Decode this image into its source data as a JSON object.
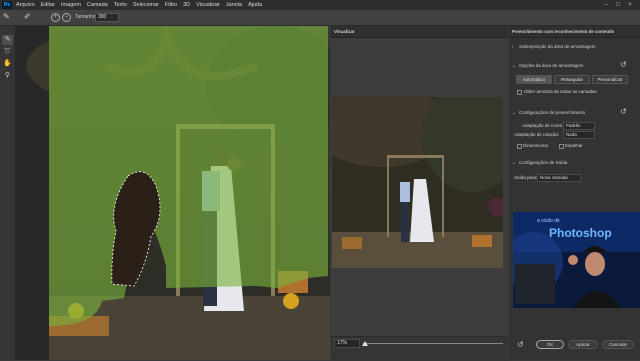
{
  "menu": {
    "app_icon": "Ps",
    "items": [
      "Arquivo",
      "Editar",
      "Imagem",
      "Camada",
      "Texto",
      "Selecionar",
      "Filtro",
      "3D",
      "Visualizar",
      "Janela",
      "Ajuda"
    ]
  },
  "options": {
    "size_label": "Tamanho:",
    "size_value": "380"
  },
  "preview": {
    "title": "Visualizar",
    "zoom": "17%"
  },
  "panel": {
    "title": "Preenchimento com reconhecimento de conteúdo",
    "sampling_overlay": "Sobreposição da área de amostragem",
    "sampling_options_header": "Opções da área de amostragem",
    "sampling_buttons": [
      "Automático",
      "Retangular",
      "Personalizar"
    ],
    "sample_all_layers": "Obter amostra de todas as camadas",
    "fill_settings_header": "Configurações de preenchimento",
    "color_adaptation_label": "Adaptação de cores:",
    "color_adaptation_value": "Padrão",
    "rotation_adaptation_label": "Adaptação de rotação:",
    "rotation_adaptation_value": "Nada",
    "scale_label": "Dimensionar",
    "mirror_label": "Espelhar",
    "output_settings_header": "Configurações de Saída",
    "output_label": "Saída para:",
    "output_value": "Nova camada",
    "ok": "OK",
    "apply": "Aplicar",
    "cancel": "Cancelar"
  },
  "webcam": {
    "overlay_text_1": "a visão de",
    "overlay_text_2": "Photoshop"
  },
  "colors": {
    "overlay_green": "#7ab33c",
    "panel_bg": "#333333",
    "accent_blue": "#31a8ff"
  }
}
